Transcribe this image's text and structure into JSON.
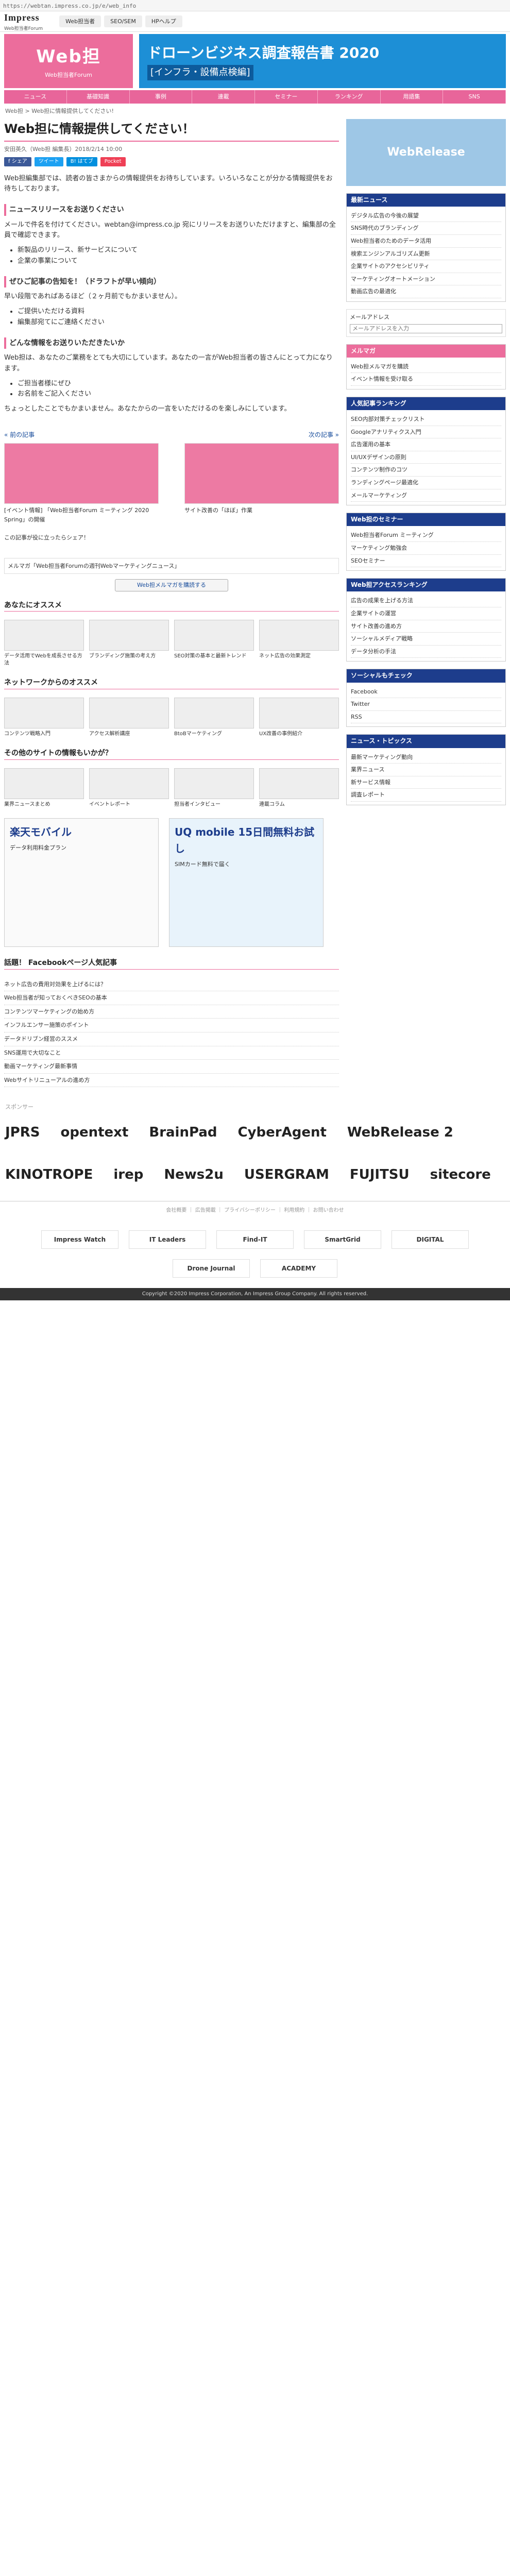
{
  "url": "https://webtan.impress.co.jp/e/web_info",
  "impress": {
    "name": "Impress",
    "sub": "Web担当者Forum",
    "tabs": [
      "Web担当者",
      "SEO/SEM",
      "HPヘルプ"
    ]
  },
  "brand": {
    "name": "Web担",
    "sub": "Web担当者Forum"
  },
  "adtop": {
    "line1": "ドローンビジネス調査報告書 2020",
    "line2": "[インフラ・設備点検編]"
  },
  "nav": [
    "ニュース",
    "基礎知識",
    "事例",
    "連載",
    "セミナー",
    "ランキング",
    "用語集",
    "SNS"
  ],
  "crumb": "Web担 > Web担に情報提供してください!",
  "article": {
    "title": "Web担に情報提供してください！",
    "meta": "安田英久（Web担 編集長）2018/2/14 10:00",
    "share": [
      "f シェア",
      "ツイート",
      "B! はてブ",
      "Pocket"
    ],
    "intro": "Web担編集部では、読者の皆さまからの情報提供をお待ちしています。いろいろなことが分かる情報提供をお待ちしております。",
    "h1": "ニュースリリースをお送りください",
    "p1": "メールで件名を付けてください。webtan@impress.co.jp 宛にリリースをお送りいただけますと、編集部の全員で確認できます。",
    "list1": [
      "新製品のリリース、新サービスについて",
      "企業の事業について"
    ],
    "h2": "ぜひご記事の告知を！（ドラフトが早い傾向）",
    "p2": "早い段階であればあるほど（２ヶ月前でもかまいません）。",
    "list2": [
      "ご提供いただける資料",
      "編集部宛てにご連絡ください"
    ],
    "h3": "どんな情報をお送りいただきたいか",
    "p3": "Web担は、あなたのご業務をとても大切にしています。あなたの一言がWeb担当者の皆さんにとって力になります。",
    "list3": [
      "ご担当者様にぜひ",
      "お名前をご記入ください"
    ],
    "closing": "ちょっとしたことでもかまいません。あなたからの一言をいただけるのを楽しみにしています。"
  },
  "prevnext": {
    "prev": "« 前の記事",
    "next": "次の記事 »",
    "prev_title": "[イベント情報] 「Web担当者Forum ミーティング 2020 Spring」の開催",
    "next_title": "サイト改善の「ほぼ」作業"
  },
  "related": "この記事が役に立ったらシェア！",
  "eye": "メルマガ「Web担当者Forumの週刊Webマーケティングニュース」",
  "wbtn": "Web担メルマガを購読する",
  "sections": {
    "osusume": "あなたにオススメ",
    "network": "ネットワークからのオススメ",
    "others": "その他のサイトの情報もいかが？"
  },
  "cards1": [
    {
      "t": "データ活用でWebを成長させる方法"
    },
    {
      "t": "ブランディング施策の考え方"
    },
    {
      "t": "SEO対策の基本と最新トレンド"
    },
    {
      "t": "ネット広告の効果測定"
    }
  ],
  "cards2": [
    {
      "t": "コンテンツ戦略入門"
    },
    {
      "t": "アクセス解析講座"
    },
    {
      "t": "BtoBマーケティング"
    },
    {
      "t": "UX改善の事例紹介"
    }
  ],
  "cards3": [
    {
      "t": "業界ニュースまとめ"
    },
    {
      "t": "イベントレポート"
    },
    {
      "t": "担当者インタビュー"
    },
    {
      "t": "連載コラム"
    }
  ],
  "ads": {
    "a1": "楽天モバイル",
    "a1sub": "データ利用料金プラン",
    "a2": "UQ mobile 15日間無料お試し",
    "a2sub": "SIMカード無料で届く"
  },
  "news_head": "話題！ Facebookページ人気記事",
  "news": [
    "ネット広告の費用対効果を上げるには？",
    "Web担当者が知っておくべきSEOの基本",
    "コンテンツマーケティングの始め方",
    "インフルエンサー施策のポイント",
    "データドリブン経営のススメ",
    "SNS運用で大切なこと",
    "動画マーケティング最新事情",
    "Webサイトリニューアルの進め方"
  ],
  "spons_label": "スポンサー",
  "sponsors": [
    "JPRS",
    "opentext",
    "BrainPad",
    "CyberAgent",
    "WebRelease 2",
    "KINOTROPE",
    "irep",
    "News2u",
    "USERGRAM",
    "FUJITSU",
    "sitecore"
  ],
  "footer": {
    "links": "会社概要 ｜ 広告掲載 ｜ プライバシーポリシー ｜ 利用規約 ｜ お問い合わせ",
    "logos": [
      "Impress Watch",
      "IT Leaders",
      "Find-IT",
      "SmartGrid",
      "DIGITAL",
      "Drone Journal",
      "ACADEMY"
    ],
    "copy": "Copyright ©2020 Impress Corporation, An Impress Group Company. All rights reserved."
  },
  "side": {
    "wr": "WebRelease",
    "boxes": [
      {
        "head": "最新ニュース",
        "items": [
          "デジタル広告の今後の展望",
          "SNS時代のブランディング",
          "Web担当者のためのデータ活用",
          "検索エンジンアルゴリズム更新",
          "企業サイトのアクセシビリティ",
          "マーケティングオートメーション",
          "動画広告の最適化"
        ]
      },
      {
        "head": "メルマガ",
        "items": [
          "Web担メルマガを購読",
          "イベント情報を受け取る"
        ]
      },
      {
        "head": "人気記事ランキング",
        "items": [
          "SEO内部対策チェックリスト",
          "Googleアナリティクス入門",
          "広告運用の基本",
          "UI/UXデザインの原則",
          "コンテンツ制作のコツ",
          "ランディングページ最適化",
          "メールマーケティング"
        ]
      },
      {
        "head": "Web担のセミナー",
        "items": [
          "Web担当者Forum ミーティング",
          "マーケティング勉強会",
          "SEOセミナー"
        ]
      },
      {
        "head": "Web担アクセスランキング",
        "items": [
          "広告の成果を上げる方法",
          "企業サイトの運営",
          "サイト改善の進め方",
          "ソーシャルメディア戦略",
          "データ分析の手法"
        ]
      },
      {
        "head": "ソーシャルもチェック",
        "items": [
          "Facebook",
          "Twitter",
          "RSS"
        ]
      },
      {
        "head": "ニュース・トピックス",
        "items": [
          "最新マーケティング動向",
          "業界ニュース",
          "新サービス情報",
          "調査レポート"
        ]
      }
    ],
    "form_label": "メールアドレス",
    "form_placeholder": "メールアドレスを入力"
  }
}
